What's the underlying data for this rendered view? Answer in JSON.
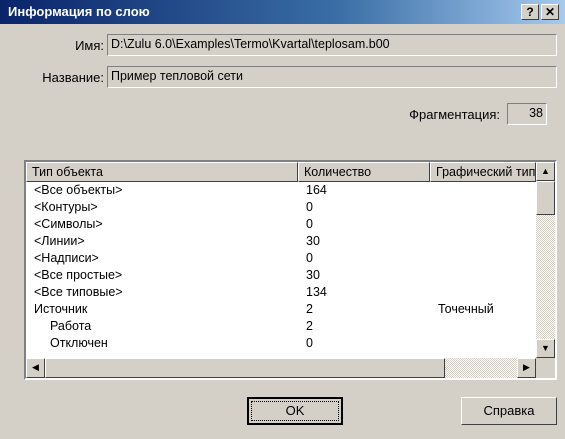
{
  "window": {
    "title": "Информация по слою",
    "help_label": "?",
    "close_label": "✕"
  },
  "form": {
    "name_label": "Имя:",
    "name_value": "D:\\Zulu 6.0\\Examples\\Termo\\Kvartal\\teplosam.b00",
    "title_label": "Название:",
    "title_value": "Пример тепловой сети",
    "frag_label": "Фрагментация:",
    "frag_value": "38"
  },
  "table": {
    "headers": [
      "Тип объекта",
      "Количество",
      "Графический тип"
    ],
    "rows": [
      {
        "type": "<Все объекты>",
        "count": "164",
        "graphic": ""
      },
      {
        "type": "<Контуры>",
        "count": "0",
        "graphic": ""
      },
      {
        "type": "<Символы>",
        "count": "0",
        "graphic": ""
      },
      {
        "type": "<Линии>",
        "count": "30",
        "graphic": ""
      },
      {
        "type": "<Надписи>",
        "count": "0",
        "graphic": ""
      },
      {
        "type": "<Все простые>",
        "count": "30",
        "graphic": ""
      },
      {
        "type": "<Все типовые>",
        "count": "134",
        "graphic": ""
      },
      {
        "type": "Источник",
        "count": "2",
        "graphic": "Точечный"
      },
      {
        "type": "Работа",
        "count": "2",
        "graphic": ""
      },
      {
        "type": "Отключен",
        "count": "0",
        "graphic": ""
      }
    ]
  },
  "buttons": {
    "ok_label": "OK",
    "help_label": "Справка"
  },
  "icons": {
    "up_arrow": "▲",
    "down_arrow": "▼",
    "left_arrow": "◀",
    "right_arrow": "▶"
  }
}
